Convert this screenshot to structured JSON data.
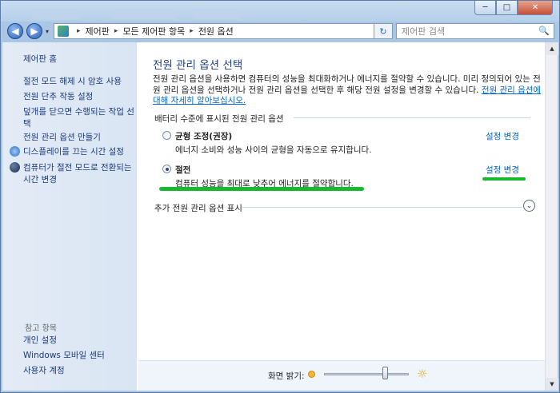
{
  "window": {
    "minimize_glyph": "─",
    "maximize_glyph": "□",
    "close_glyph": "✕"
  },
  "address": {
    "back_glyph": "◀",
    "forward_glyph": "▶",
    "crumbs": [
      "제어판",
      "모든 제어판 항목",
      "전원 옵션"
    ],
    "separator": "▸",
    "dropdown_glyph": "▾",
    "refresh_glyph": "↻",
    "search_placeholder": "제어판 검색",
    "search_icon_glyph": "🔍"
  },
  "sidebar": {
    "home": "제어판 홈",
    "links": [
      "절전 모드 해제 시 암호 사용",
      "전원 단추 작동 설정",
      "덮개를 닫으면 수행되는 작업 선택",
      "전원 관리 옵션 만들기",
      "디스플레이를 끄는 시간 설정",
      "컴퓨터가 절전 모드로 전환되는 시간 변경"
    ],
    "see_also": "참고 항목",
    "see_also_links": [
      "개인 설정",
      "Windows 모바일 센터",
      "사용자 계정"
    ]
  },
  "main": {
    "title": "전원 관리 옵션 선택",
    "intro": "전원 관리 옵션을 사용하면 컴퓨터의 성능을 최대화하거나 에너지를 절약할 수 있습니다. 미리 정의되어 있는 전원 관리 옵션을 선택하거나 전원 관리 옵션을 선택한 후 해당 전원 설정을 변경할 수 있습니다.",
    "intro_link": "전원 관리 옵션에 대해 자세히 알아보십시오.",
    "section_label": "배터리 수준에 표시된 전원 관리 옵션",
    "plans": [
      {
        "name": "균형 조정(권장)",
        "desc": "에너지 소비와 성능 사이의 균형을 자동으로 유지합니다.",
        "link": "설정 변경",
        "selected": false
      },
      {
        "name": "절전",
        "desc": "컴퓨터 성능을 최대로 낮추어 에너지를 절약합니다.",
        "link": "설정 변경",
        "selected": true
      }
    ],
    "more_label": "추가 전원 관리 옵션 표시",
    "expand_glyph": "⌄",
    "highlight_color": "#18b830"
  },
  "bottom": {
    "brightness_label": "화면 밝기:",
    "brightness_level": 0.72,
    "sun_big_glyph": "☼"
  },
  "scroll": {
    "up_glyph": "▲",
    "down_glyph": "▼"
  }
}
